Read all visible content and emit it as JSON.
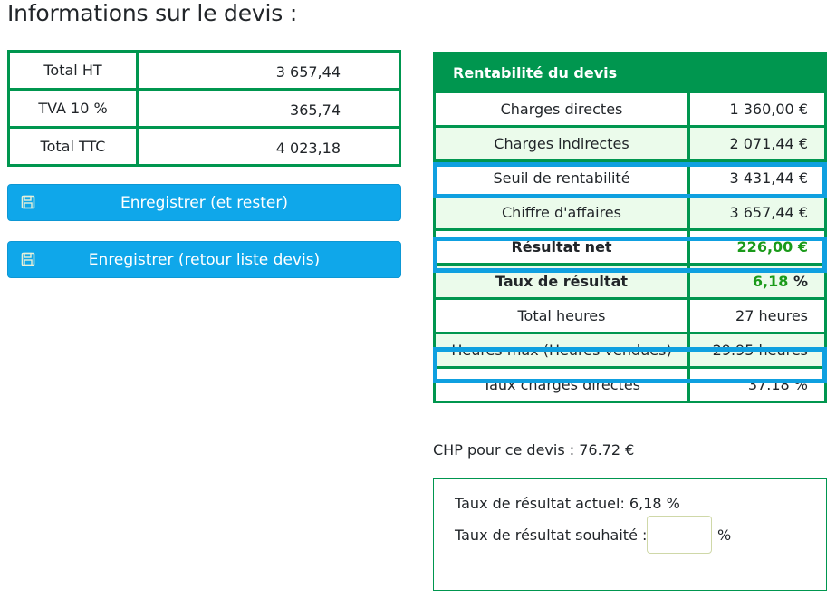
{
  "page": {
    "title": "Informations sur le devis :"
  },
  "totals": [
    {
      "label": "Total HT",
      "value": "3 657,44"
    },
    {
      "label": "TVA 10 %",
      "value": "365,74"
    },
    {
      "label": "Total TTC",
      "value": "4 023,18"
    }
  ],
  "buttons": {
    "save_stay": {
      "label": "Enregistrer (et rester)",
      "icon": "floppy-disk-icon"
    },
    "save_return": {
      "label": "Enregistrer (retour liste devis)",
      "icon": "floppy-disk-icon"
    }
  },
  "rentabilite": {
    "header": "Rentabilité du devis",
    "rows": [
      {
        "label": "Charges directes",
        "value": "1 360,00 €"
      },
      {
        "label": "Charges indirectes",
        "value": "2 071,44 €"
      },
      {
        "label": "Seuil de rentabilité",
        "value": "3 431,44 €",
        "highlighted": true
      },
      {
        "label": "Chiffre d'affaires",
        "value": "3 657,44 €"
      },
      {
        "label": "Résultat net",
        "value": "226,00 €",
        "highlighted": true,
        "bold": true
      },
      {
        "label": "Taux de résultat",
        "value": "6,18",
        "unit": "%",
        "bold": true
      },
      {
        "label": "Total heures",
        "value": "27 heures"
      },
      {
        "label": "Heures max (Heures vendues)",
        "value": "29.95 heures",
        "highlighted": true
      },
      {
        "label": "Taux charges directes",
        "value": "37.18 %"
      }
    ]
  },
  "chp": "CHP pour ce devis : 76.72 €",
  "simulation": {
    "current_label": "Taux de résultat actuel: 6,18 %",
    "target_label": "Taux de résultat souhaité :",
    "target_value": "",
    "target_placeholder": "",
    "unit": "%"
  },
  "colors": {
    "green_border": "#00964f",
    "button_blue": "#0fa7ea",
    "highlight_blue": "#0fa0e0",
    "positive_green": "#1a9a1a",
    "alt_row": "#ebfbeb"
  }
}
